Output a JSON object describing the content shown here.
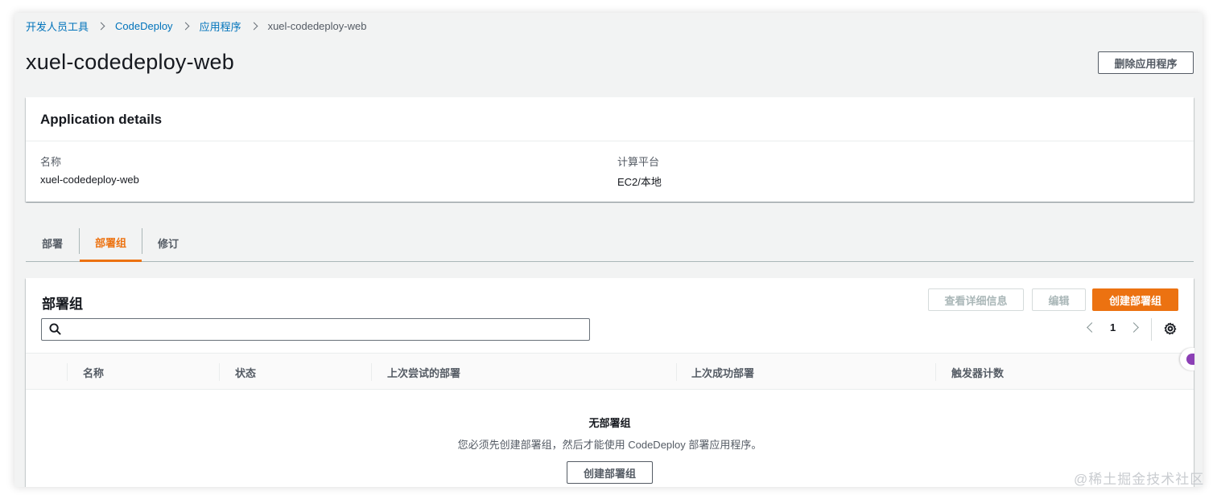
{
  "breadcrumb": {
    "items": [
      "开发人员工具",
      "CodeDeploy",
      "应用程序"
    ],
    "current": "xuel-codedeploy-web"
  },
  "page": {
    "title": "xuel-codedeploy-web",
    "delete_button": "删除应用程序"
  },
  "details": {
    "title": "Application details",
    "name_label": "名称",
    "name_value": "xuel-codedeploy-web",
    "platform_label": "计算平台",
    "platform_value": "EC2/本地"
  },
  "tabs": [
    {
      "label": "部署",
      "active": false
    },
    {
      "label": "部署组",
      "active": true
    },
    {
      "label": "修订",
      "active": false
    }
  ],
  "groups": {
    "title": "部署组",
    "view_details_button": "查看详细信息",
    "edit_button": "编辑",
    "create_button": "创建部署组",
    "search": {
      "value": "",
      "placeholder": ""
    },
    "page_number": "1",
    "columns": [
      "名称",
      "状态",
      "上次尝试的部署",
      "上次成功部署",
      "触发器计数"
    ],
    "empty_title": "无部署组",
    "empty_description": "您必须先创建部署组，然后才能使用 CodeDeploy 部署应用程序。",
    "empty_create_button": "创建部署组"
  },
  "watermark": "@稀土掘金技术社区",
  "colors": {
    "accent": "#ec7211",
    "link": "#0073bb",
    "background": "#f2f3f3"
  }
}
